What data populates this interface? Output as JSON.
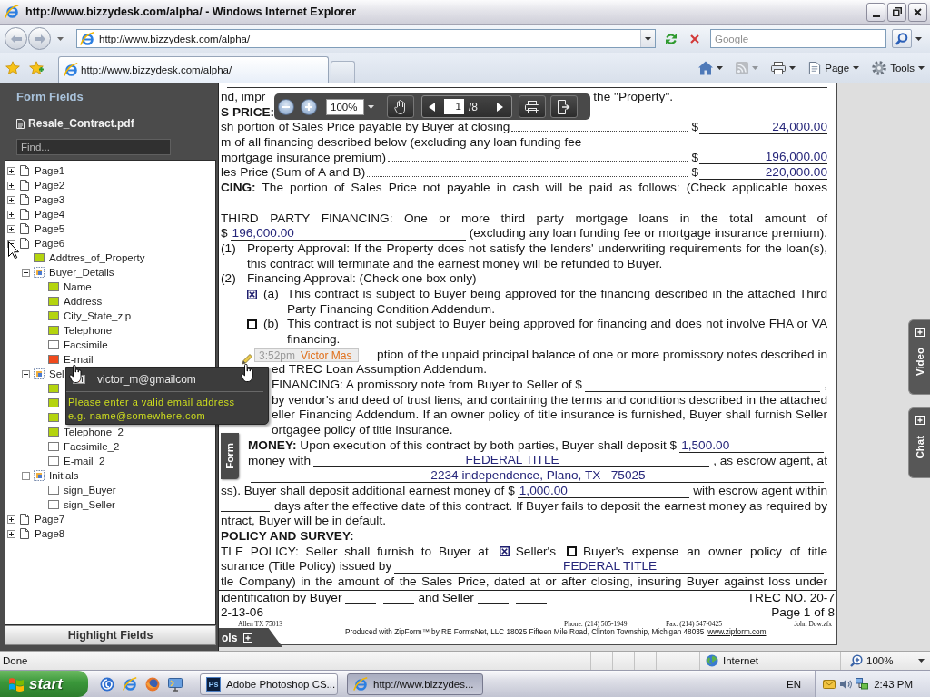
{
  "window": {
    "title": "http://www.bizzydesk.com/alpha/ - Windows Internet Explorer"
  },
  "address_bar": {
    "url": "http://www.bizzydesk.com/alpha/"
  },
  "search_box": {
    "placeholder": "Google"
  },
  "tabs": [
    {
      "label": "http://www.bizzydesk.com/alpha/",
      "selected": true
    }
  ],
  "command_bar": [
    {
      "kind": "home",
      "disabled": false
    },
    {
      "kind": "feeds",
      "disabled": true
    },
    {
      "kind": "print",
      "disabled": false
    },
    {
      "kind": "page",
      "label": "Page",
      "disabled": false
    },
    {
      "kind": "tools",
      "label": "Tools",
      "disabled": false
    }
  ],
  "form_panel": {
    "title": "Form Fields",
    "file": "Resale_Contract.pdf",
    "find": {
      "placeholder": "Find..."
    },
    "tree": [
      {
        "label": "Page1",
        "kind": "page",
        "expanded": false
      },
      {
        "label": "Page2",
        "kind": "page",
        "expanded": false
      },
      {
        "label": "Page3",
        "kind": "page",
        "expanded": false
      },
      {
        "label": "Page4",
        "kind": "page",
        "expanded": false
      },
      {
        "label": "Page5",
        "kind": "page",
        "expanded": false
      },
      {
        "label": "Page6",
        "kind": "page",
        "expanded": true,
        "children": [
          {
            "label": "Addtres_of_Property",
            "kind": "field",
            "color": "#b4d40e"
          },
          {
            "label": "Buyer_Details",
            "kind": "group",
            "expanded": true,
            "children": [
              {
                "label": "Name",
                "kind": "field",
                "color": "#b4d40e"
              },
              {
                "label": "Address",
                "kind": "field",
                "color": "#b4d40e"
              },
              {
                "label": "City_State_zip",
                "kind": "field",
                "color": "#b4d40e"
              },
              {
                "label": "Telephone",
                "kind": "field",
                "color": "#b4d40e"
              },
              {
                "label": "Facsimile",
                "kind": "field",
                "color": "#ffffff"
              },
              {
                "label": "E-mail",
                "kind": "field",
                "color": "#f04a1c"
              }
            ]
          },
          {
            "label": "Sel",
            "kind": "group",
            "expanded": true,
            "children": [
              {
                "kind": "field",
                "color": "#b4d40e"
              },
              {
                "kind": "field",
                "color": "#b4d40e"
              },
              {
                "kind": "field",
                "color": "#b4d40e"
              },
              {
                "label": "Telephone_2",
                "kind": "field",
                "color": "#b4d40e"
              },
              {
                "label": "Facsimile_2",
                "kind": "field",
                "color": "#ffffff"
              },
              {
                "label": "E-mail_2",
                "kind": "field",
                "color": "#ffffff"
              }
            ]
          },
          {
            "label": "Initials",
            "kind": "group",
            "expanded": true,
            "children": [
              {
                "label": "sign_Buyer",
                "kind": "field",
                "color": "#ffffff"
              },
              {
                "label": "sign_Seller",
                "kind": "field",
                "color": "#ffffff"
              }
            ]
          }
        ]
      },
      {
        "label": "Page7",
        "kind": "page",
        "expanded": false
      },
      {
        "label": "Page8",
        "kind": "page",
        "expanded": false
      }
    ],
    "button": "Highlight Fields"
  },
  "field_popup": {
    "time": "3:52pm",
    "author": "Victor Mas",
    "value": "victor_m@gmailcom",
    "message": [
      "Please enter a valid email address",
      "e.g. name@somewhere.com"
    ]
  },
  "viewer_toolbar": {
    "zoom": "100%",
    "page": "1",
    "page_count": "/8"
  },
  "form_tab": {
    "label": "Form"
  },
  "bottom_tab": {
    "label": "ols"
  },
  "side_tabs": [
    {
      "label": "Video"
    },
    {
      "label": "Chat"
    }
  ],
  "document": {
    "blocks": [
      {
        "kind": "plain",
        "lines": [
          {
            "kind": "cut",
            "left": "nd, impr",
            "right": "the \"Property\"."
          },
          {
            "kind": "heading",
            "text": "S PRICE:"
          },
          {
            "kind": "amount",
            "text": "sh portion of Sales Price payable by Buyer at closing",
            "currency": "$",
            "value": "24,000.00"
          },
          {
            "kind": "left",
            "text": "m of all financing described below (excluding any loan funding fee"
          },
          {
            "kind": "amount",
            "text": "mortgage insurance premium)",
            "currency": "$",
            "value": "196,000.00"
          },
          {
            "kind": "amount",
            "text": "les Price (Sum of A and B)",
            "currency": "$",
            "value": "220,000.00"
          },
          {
            "kind": "full",
            "text": "**CING:** The portion of Sales Price not payable in cash will be paid as follows: (Check applicable boxes"
          },
          {
            "kind": "blank"
          },
          {
            "kind": "full",
            "text": "THIRD PARTY FINANCING: One or more third party mortgage loans in the total amount of"
          },
          {
            "kind": "fill",
            "text": "$",
            "value": "196,000.00",
            "after": "(excluding any loan funding fee or mortgage insurance premium)."
          }
        ]
      },
      {
        "kind": "numbered",
        "number": "(1)",
        "lines": [
          {
            "kind": "full",
            "text": "Property Approval: If the Property does not satisfy the lenders' underwriting requirements for the loan(s),"
          },
          {
            "kind": "left",
            "text": "this contract will terminate and the earnest money will be refunded to Buyer."
          }
        ]
      },
      {
        "kind": "numbered",
        "number": "(2)",
        "lines": [
          {
            "kind": "left",
            "text": "Financing Approval: (Check one box only)"
          }
        ]
      },
      {
        "kind": "option",
        "checked": true,
        "letter": "(a)",
        "lines": [
          {
            "kind": "full",
            "text": "This contract is subject to Buyer being approved for the financing described in the attached Third"
          },
          {
            "kind": "left",
            "text": "Party Financing Condition Addendum."
          }
        ]
      },
      {
        "kind": "option",
        "checked": false,
        "letter": "(b)",
        "lines": [
          {
            "kind": "full",
            "text": "This contract is not subject to Buyer being approved for financing and does not involve FHA or VA"
          },
          {
            "kind": "left",
            "text": "financing."
          }
        ]
      },
      {
        "kind": "covered",
        "lines": [
          {
            "kind": "right",
            "text": "ption of the unpaid principal balance of one or more promissory notes described in"
          },
          {
            "kind": "left",
            "text": "ed TREC Loan Assumption Addendum."
          },
          {
            "kind": "fill",
            "text": "FINANCING: A promissory note from Buyer to Seller of $",
            "after": ","
          },
          {
            "kind": "full",
            "text": "by vendor's and deed of trust liens, and containing the terms and conditions described in the attached"
          },
          {
            "kind": "full",
            "text": "eller Financing Addendum. If an owner policy of title insurance is furnished, Buyer shall furnish Seller"
          },
          {
            "kind": "left",
            "text": "ortgagee policy of title insurance."
          }
        ]
      },
      {
        "kind": "beside_tab",
        "lines": [
          {
            "kind": "fill",
            "text": "**MONEY:** Upon execution of this contract by both parties, Buyer shall deposit $",
            "value": "1,500.00"
          },
          {
            "kind": "fill_centered",
            "text": "money with",
            "value": "FEDERAL TITLE",
            "after": ", as escrow agent, at"
          },
          {
            "kind": "fill_centered",
            "value": "2234 independence, Plano, TX   75025"
          }
        ]
      },
      {
        "kind": "plain",
        "lines": [
          {
            "kind": "fill",
            "text": "ss). Buyer shall deposit additional earnest money of $",
            "value": "1,000.00",
            "after": "with escrow agent within"
          },
          {
            "kind": "lead_blank",
            "text": "days after the effective date of this contract. If Buyer fails to deposit the earnest money as required by"
          },
          {
            "kind": "left",
            "text": "ntract, Buyer will be in default."
          },
          {
            "kind": "heading",
            "text": "POLICY AND SURVEY:"
          },
          {
            "kind": "choice",
            "text": "TLE POLICY: Seller shall furnish to Buyer at",
            "options": [
              {
                "label": "Seller's",
                "checked": true
              },
              {
                "label": "Buyer's expense an owner policy of title",
                "checked": false
              }
            ]
          },
          {
            "kind": "fill_centered",
            "text": "surance (Title Policy) issued by",
            "value": "FEDERAL TITLE"
          },
          {
            "kind": "full",
            "text": "tle Company) in the amount of the Sales Price, dated at or after closing, insuring Buyer against loss under"
          }
        ]
      }
    ],
    "footer": [
      {
        "kind": "signoff",
        "text": "identification by Buyer",
        "middle": "and Seller",
        "right": "TREC NO. 20-7"
      },
      {
        "kind": "pair",
        "left": "2-13-06",
        "right": "Page 1 of 8"
      },
      {
        "kind": "meta",
        "items": [
          "Allen TX 75013",
          "Phone: (214) 505-1949",
          "Fax: (214) 547-0425",
          "John Dow.zfx"
        ]
      },
      {
        "kind": "credit",
        "text": "Produced with ZipForm™ by RE FormsNet, LLC 18025 Fifteen Mile Road, Clinton Township, Michigan 48035",
        "link": "www.zipform.com"
      }
    ]
  },
  "status_bar": {
    "text": "Done",
    "zone": "Internet",
    "zoom": "100%"
  },
  "taskbar": {
    "start": "start",
    "tasks": [
      {
        "label": "Adobe Photoshop CS...",
        "kind": "photoshop",
        "logo": "Ps",
        "selected": false
      },
      {
        "label": "http://www.bizzydes...",
        "kind": "browser",
        "selected": true
      }
    ],
    "language": "EN",
    "clock": "2:43 PM"
  }
}
